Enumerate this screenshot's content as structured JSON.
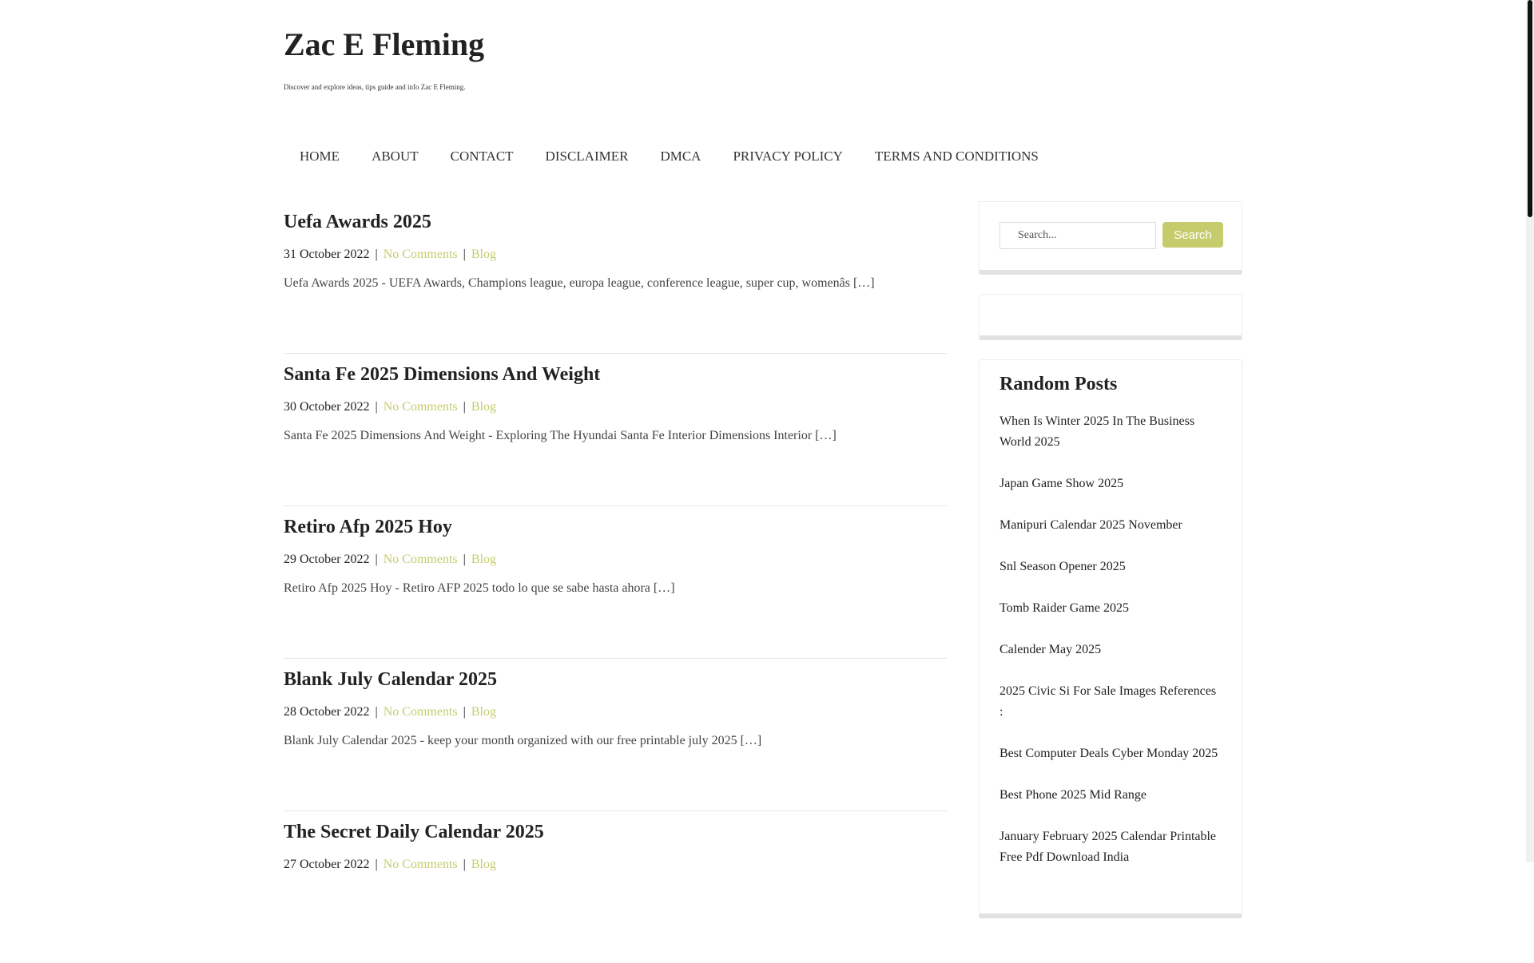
{
  "site": {
    "title": "Zac E Fleming",
    "description": "Discover and explore ideas, tips guide and info Zac E Fleming."
  },
  "nav": [
    "HOME",
    "ABOUT",
    "CONTACT",
    "DISCLAIMER",
    "DMCA",
    "PRIVACY POLICY",
    "TERMS AND CONDITIONS"
  ],
  "posts": [
    {
      "title": "Uefa Awards 2025",
      "date": "31 October 2022",
      "comments": "No Comments",
      "category": "Blog",
      "excerpt": "Uefa Awards 2025 - UEFA Awards, Champions league, europa league, conference league, super cup, womenâs […]"
    },
    {
      "title": "Santa Fe 2025 Dimensions And Weight",
      "date": "30 October 2022",
      "comments": "No Comments",
      "category": "Blog",
      "excerpt": "Santa Fe 2025 Dimensions And Weight - Exploring The Hyundai Santa Fe Interior Dimensions Interior […]"
    },
    {
      "title": "Retiro Afp 2025 Hoy",
      "date": "29 October 2022",
      "comments": "No Comments",
      "category": "Blog",
      "excerpt": "Retiro Afp 2025 Hoy - Retiro AFP 2025 todo lo que se sabe hasta ahora […]"
    },
    {
      "title": "Blank July Calendar 2025",
      "date": "28 October 2022",
      "comments": "No Comments",
      "category": "Blog",
      "excerpt": "Blank July Calendar 2025 - keep your month organized with our free printable july 2025 […]"
    },
    {
      "title": "The Secret Daily Calendar 2025",
      "date": "27 October 2022",
      "comments": "No Comments",
      "category": "Blog",
      "excerpt": ""
    }
  ],
  "search": {
    "placeholder": "Search...",
    "button": "Search"
  },
  "random_posts": {
    "title": "Random Posts",
    "items": [
      "When Is Winter 2025 In The Business World 2025",
      "Japan Game Show 2025",
      "Manipuri Calendar 2025 November",
      "Snl Season Opener 2025",
      "Tomb Raider Game 2025",
      "Calender May 2025",
      "2025 Civic Si For Sale Images References :",
      "Best Computer Deals Cyber Monday 2025",
      "Best Phone 2025 Mid Range",
      "January February 2025 Calendar Printable Free Pdf Download India"
    ]
  },
  "colors": {
    "accent": "#c6cc6c"
  }
}
